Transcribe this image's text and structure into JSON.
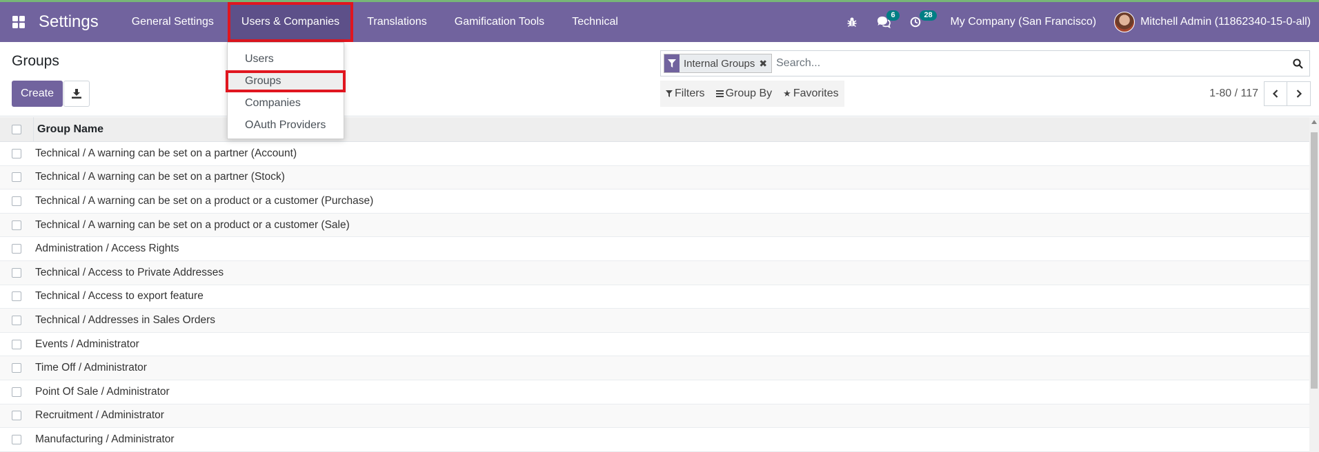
{
  "navbar": {
    "app_name": "Settings",
    "menus": [
      {
        "label": "General Settings"
      },
      {
        "label": "Users & Companies"
      },
      {
        "label": "Translations"
      },
      {
        "label": "Gamification Tools"
      },
      {
        "label": "Technical"
      }
    ],
    "icons": {
      "apps": "grid-icon",
      "debug": "bug-icon",
      "messages": "chat-icon",
      "activities": "clock-icon"
    },
    "messages_count": "6",
    "activities_count": "28",
    "company": "My Company (San Francisco)",
    "user": "Mitchell Admin (11862340-15-0-all)"
  },
  "dropdown": {
    "items": [
      {
        "label": "Users"
      },
      {
        "label": "Groups"
      },
      {
        "label": "Companies"
      },
      {
        "label": "OAuth Providers"
      }
    ]
  },
  "control_panel": {
    "title": "Groups",
    "create_label": "Create",
    "search": {
      "facet_value": "Internal Groups",
      "facet_remove": "✖",
      "placeholder": "Search..."
    },
    "filters_label": "Filters",
    "group_by_label": "Group By",
    "favorites_label": "Favorites",
    "pager": "1-80 / 117"
  },
  "table": {
    "header": "Group Name",
    "rows": [
      "Technical / A warning can be set on a partner (Account)",
      "Technical / A warning can be set on a partner (Stock)",
      "Technical / A warning can be set on a product or a customer (Purchase)",
      "Technical / A warning can be set on a product or a customer (Sale)",
      "Administration / Access Rights",
      "Technical / Access to Private Addresses",
      "Technical / Access to export feature",
      "Technical / Addresses in Sales Orders",
      "Events / Administrator",
      "Time Off / Administrator",
      "Point Of Sale / Administrator",
      "Recruitment / Administrator",
      "Manufacturing / Administrator"
    ]
  },
  "colors": {
    "brand": "#71639e",
    "highlight": "#e0161f",
    "badge": "#017e84"
  }
}
